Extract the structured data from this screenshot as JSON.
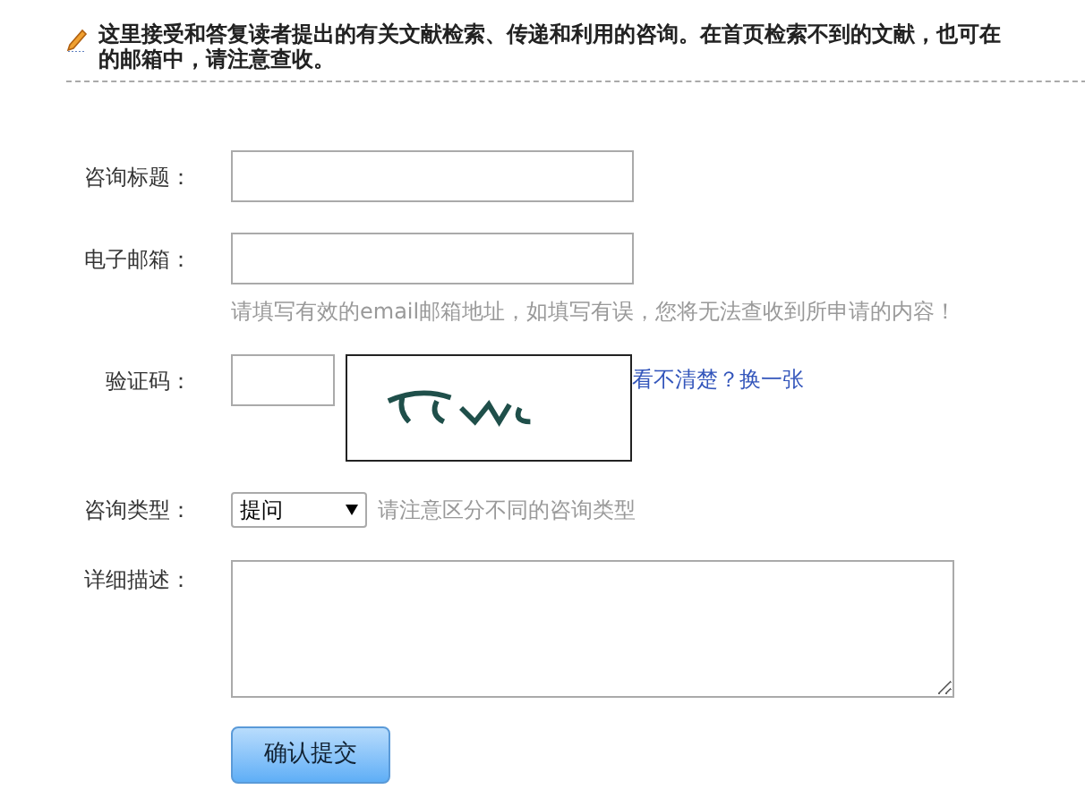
{
  "notice": {
    "lines": [
      "这里接受和答复读者提出的有关文献检索、传递和利用的咨询。在首页检索不到的文献，也可在",
      "的邮箱中，请注意查收。"
    ]
  },
  "form": {
    "title_field": {
      "label": "咨询标题："
    },
    "email_field": {
      "label": "电子邮箱：",
      "hint": "请填写有效的email邮箱地址，如填写有误，您将无法查收到所申请的内容！"
    },
    "captcha": {
      "label": "验证码：",
      "refresh_link": "看不清楚？换一张"
    },
    "type_select": {
      "label": "咨询类型：",
      "value": "提问",
      "hint": "请注意区分不同的咨询类型"
    },
    "description": {
      "label": "详细描述："
    },
    "submit_button": "确认提交"
  }
}
